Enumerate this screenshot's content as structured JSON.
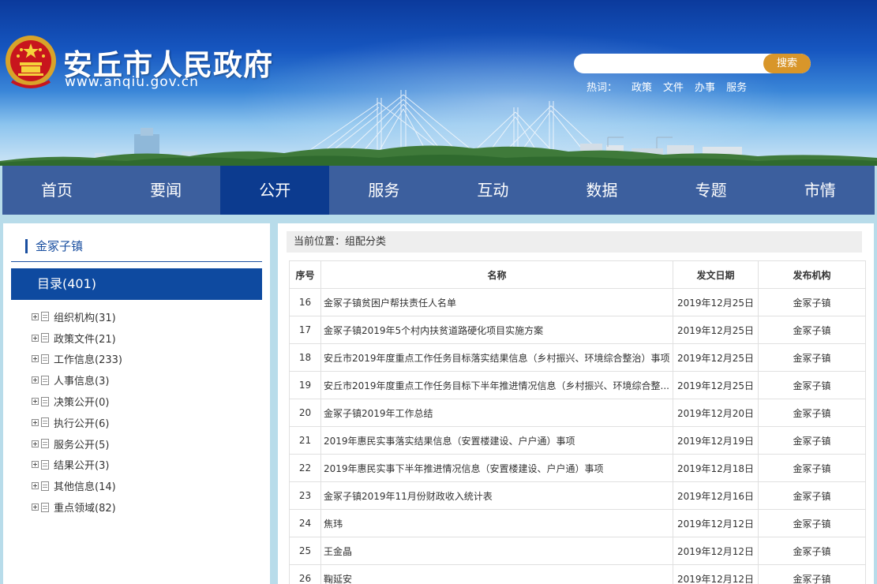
{
  "header": {
    "site_name": "安丘市人民政府",
    "site_url": "www.anqiu.gov.cn",
    "search": {
      "placeholder": "",
      "button_label": "搜索"
    },
    "hot_words": {
      "label": "热词：",
      "items": [
        "政策",
        "文件",
        "办事",
        "服务"
      ]
    }
  },
  "nav": {
    "items": [
      "首页",
      "要闻",
      "公开",
      "服务",
      "互动",
      "数据",
      "专题",
      "市情"
    ],
    "active": "公开"
  },
  "sidebar": {
    "title": "金冢子镇",
    "catalog_label": "目录(401)",
    "tree": [
      "组织机构(31)",
      "政策文件(21)",
      "工作信息(233)",
      "人事信息(3)",
      "决策公开(0)",
      "执行公开(6)",
      "服务公开(5)",
      "结果公开(3)",
      "其他信息(14)",
      "重点领域(82)"
    ]
  },
  "main": {
    "breadcrumb": "当前位置：组配分类",
    "table": {
      "headers": [
        "序号",
        "名称",
        "发文日期",
        "发布机构"
      ],
      "rows": [
        [
          "16",
          "金冢子镇贫困户帮扶责任人名单",
          "2019年12月25日",
          "金冢子镇"
        ],
        [
          "17",
          "金冢子镇2019年5个村内扶贫道路硬化项目实施方案",
          "2019年12月25日",
          "金冢子镇"
        ],
        [
          "18",
          "安丘市2019年度重点工作任务目标落实结果信息（乡村振兴、环境综合整治）事项",
          "2019年12月25日",
          "金冢子镇"
        ],
        [
          "19",
          "安丘市2019年度重点工作任务目标下半年推进情况信息（乡村振兴、环境综合整...",
          "2019年12月25日",
          "金冢子镇"
        ],
        [
          "20",
          "金冢子镇2019年工作总结",
          "2019年12月20日",
          "金冢子镇"
        ],
        [
          "21",
          "2019年惠民实事落实结果信息（安置楼建设、户户通）事项",
          "2019年12月19日",
          "金冢子镇"
        ],
        [
          "22",
          "2019年惠民实事下半年推进情况信息（安置楼建设、户户通）事项",
          "2019年12月18日",
          "金冢子镇"
        ],
        [
          "23",
          "金冢子镇2019年11月份财政收入统计表",
          "2019年12月16日",
          "金冢子镇"
        ],
        [
          "24",
          "焦玮",
          "2019年12月12日",
          "金冢子镇"
        ],
        [
          "25",
          "王金晶",
          "2019年12月12日",
          "金冢子镇"
        ],
        [
          "26",
          "鞠延安",
          "2019年12月12日",
          "金冢子镇"
        ]
      ]
    }
  },
  "colors": {
    "nav_bg": "#3c5f9e",
    "nav_active": "#0c3b8f",
    "catalog_bg": "#0e4aa0",
    "search_button": "#d8962a",
    "page_bg": "#b8dcea"
  },
  "icons": {
    "emblem": "national-emblem-icon",
    "tree_expand": "plus-box-icon",
    "tree_doc": "document-icon"
  }
}
